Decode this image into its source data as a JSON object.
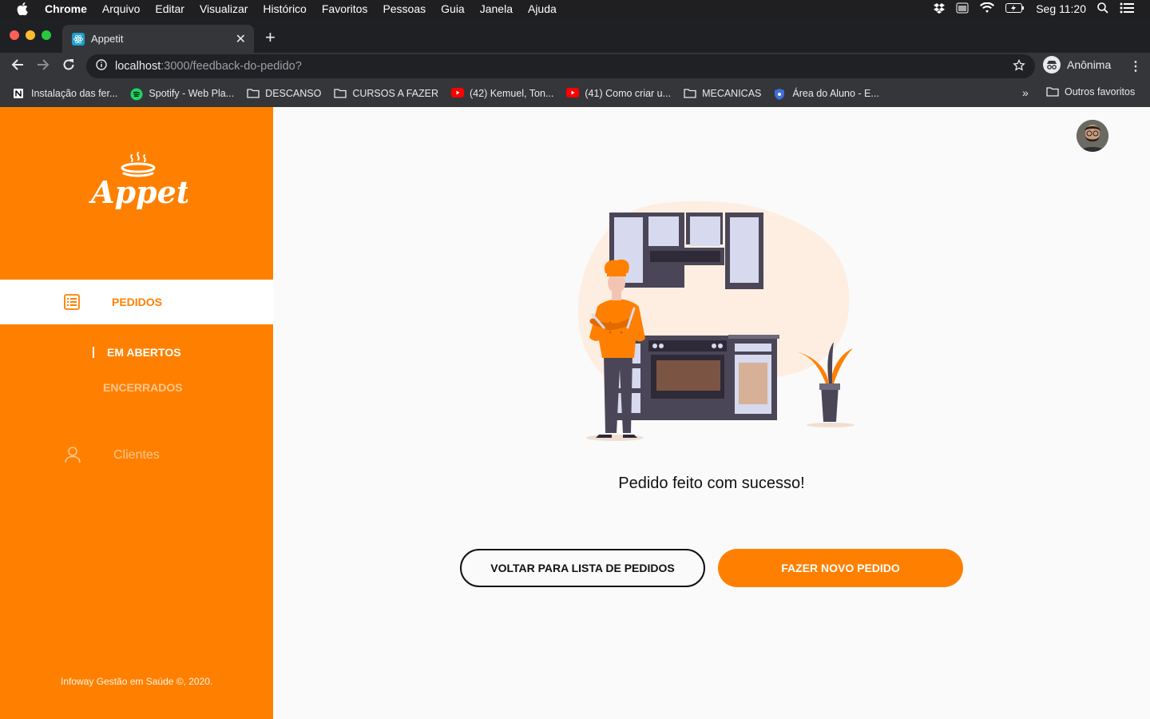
{
  "menubar": {
    "app_name": "Chrome",
    "items": [
      "Arquivo",
      "Editar",
      "Visualizar",
      "Histórico",
      "Favoritos",
      "Pessoas",
      "Guia",
      "Janela",
      "Ajuda"
    ],
    "clock": "Seg 11:20"
  },
  "browser": {
    "tab_title": "Appetit",
    "url_host": "localhost",
    "url_path": ":3000/feedback-do-pedido?",
    "profile_name": "Anônima",
    "bookmarks": [
      {
        "label": "Instalação das fer...",
        "icon": "notion-icon"
      },
      {
        "label": "Spotify - Web Pla...",
        "icon": "spotify-icon"
      },
      {
        "label": "DESCANSO",
        "icon": "folder-icon"
      },
      {
        "label": "CURSOS A FAZER",
        "icon": "folder-icon"
      },
      {
        "label": "(42) Kemuel, Ton...",
        "icon": "youtube-icon"
      },
      {
        "label": "(41) Como criar u...",
        "icon": "youtube-icon"
      },
      {
        "label": "MECANICAS",
        "icon": "folder-icon"
      },
      {
        "label": "Área do Aluno - E...",
        "icon": "shield-icon"
      }
    ],
    "other_bookmarks": "Outros favoritos"
  },
  "sidebar": {
    "brand": "Appetit",
    "nav_active": "PEDIDOS",
    "sub_open": "EM ABERTOS",
    "sub_closed": "ENCERRADOS",
    "clients": "Clientes",
    "footer": "Infoway Gestão em Saúde ©, 2020."
  },
  "main": {
    "message": "Pedido feito com sucesso!",
    "btn_back": "VOLTAR PARA LISTA DE PEDIDOS",
    "btn_new": "FAZER NOVO PEDIDO"
  },
  "colors": {
    "brand_orange": "#ff8000",
    "sidebar_muted_text": "#ffc690",
    "chrome_dark": "#35363a"
  }
}
